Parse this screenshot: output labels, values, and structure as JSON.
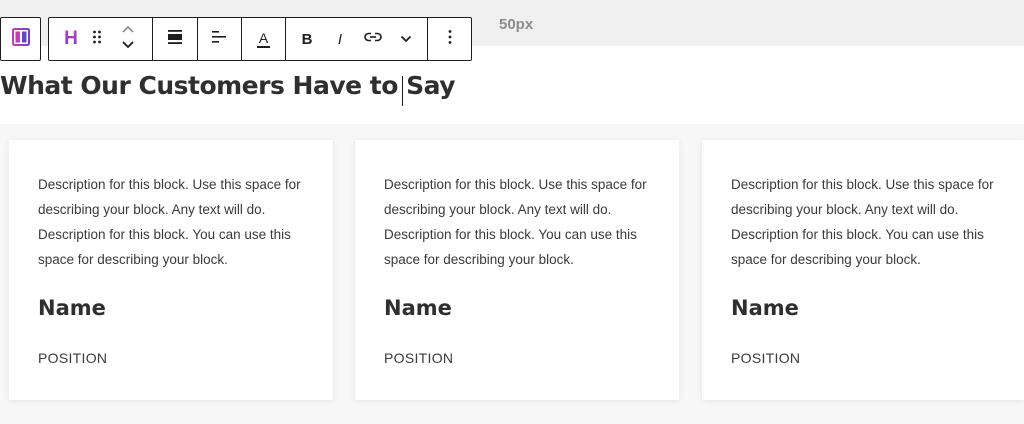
{
  "toolbar": {
    "block_type_icon": "columns-icon",
    "heading_icon": "heading-icon",
    "heading_glyph": "H",
    "drag_icon": "drag-handle-icon",
    "move_icon": "move-up-down-icon",
    "align_icon": "align-wide-icon",
    "text_align_icon": "text-align-left-icon",
    "text_color_icon": "text-color-icon",
    "text_color_glyph": "A",
    "bold_label": "B",
    "italic_label": "I",
    "link_icon": "link-icon",
    "more_rich_icon": "chevron-down-icon",
    "options_icon": "more-vertical-icon",
    "heading_color": "#8a3ffc",
    "accent_gradient": [
      "#c23fb5",
      "#6b3fd4"
    ]
  },
  "spacing_label": "50px",
  "heading": "What Our Customers Have to Say",
  "cards": [
    {
      "description": "Description for this block. Use this space for describing your block. Any text will do. Description for this block. You can use this space for describing your block.",
      "name": "Name",
      "position": "POSITION"
    },
    {
      "description": "Description for this block. Use this space for describing your block. Any text will do. Description for this block. You can use this space for describing your block.",
      "name": "Name",
      "position": "POSITION"
    },
    {
      "description": "Description for this block. Use this space for describing your block. Any text will do. Description for this block. You can use this space for describing your block.",
      "name": "Name",
      "position": "POSITION"
    }
  ]
}
